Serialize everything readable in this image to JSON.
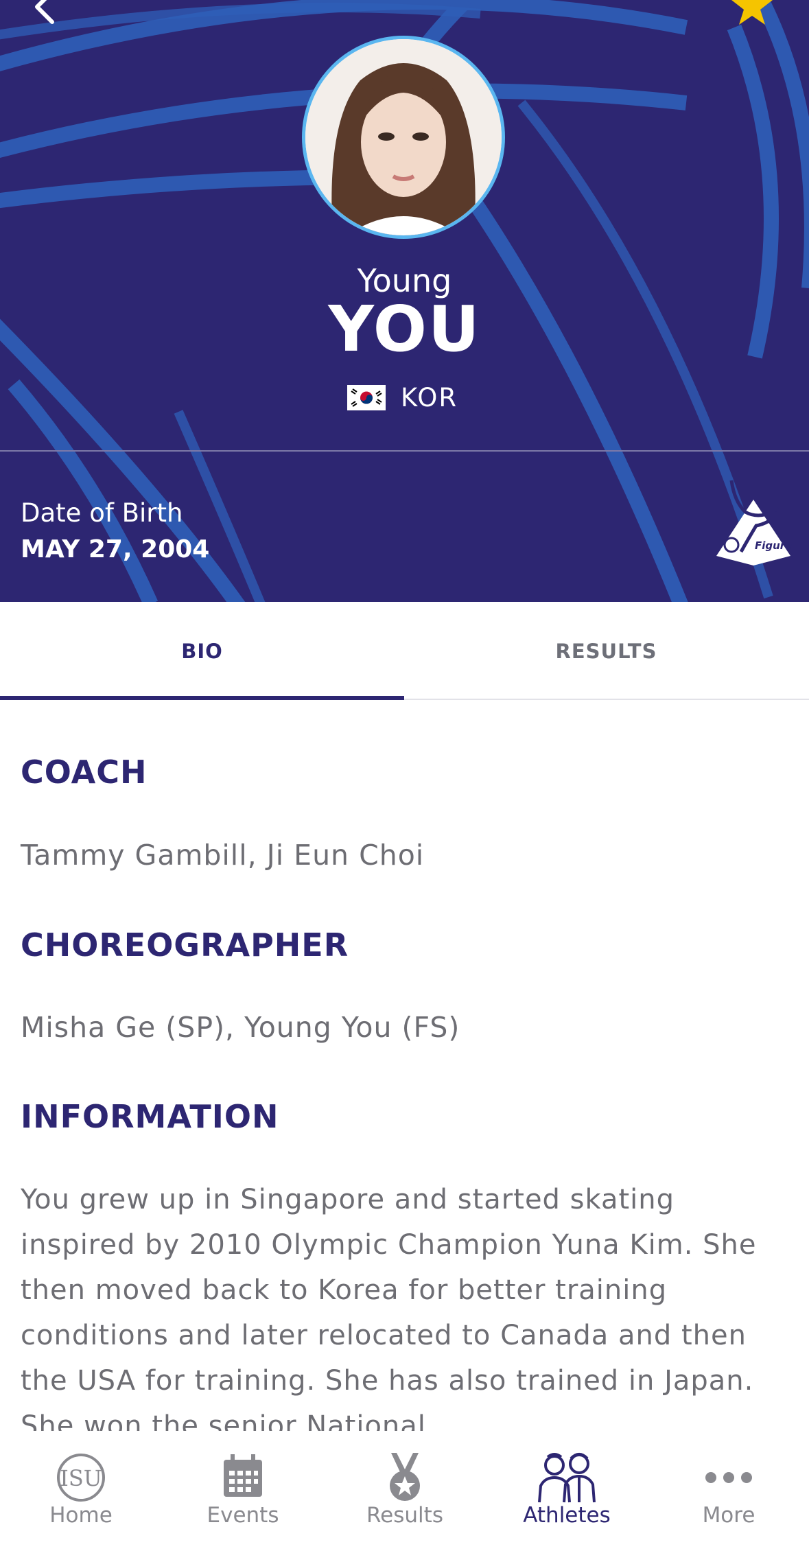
{
  "header": {
    "back_icon": "chevron-left-icon",
    "favorite_icon": "star-icon",
    "favorite_color": "#f5c400"
  },
  "athlete": {
    "first_name": "Young",
    "last_name": "YOU",
    "nation_code": "KOR",
    "dob_label": "Date of Birth",
    "dob_value": "MAY 27, 2004"
  },
  "tabs": [
    {
      "label": "BIO",
      "active": true
    },
    {
      "label": "RESULTS",
      "active": false
    }
  ],
  "bio": {
    "coach_title": "COACH",
    "coach_value": "Tammy Gambill, Ji Eun Choi",
    "choreographer_title": "CHOREOGRAPHER",
    "choreographer_value": "Misha Ge (SP), Young You (FS)",
    "information_title": "INFORMATION",
    "information_text": "You grew up in Singapore and started skating inspired by 2010 Olympic Champion Yuna Kim. She then moved back to Korea for better training conditions and later relocated to Canada and then the USA for training. She has also trained in Japan. She won the senior National"
  },
  "nav": [
    {
      "label": "Home",
      "icon": "isu-logo-icon",
      "active": false
    },
    {
      "label": "Events",
      "icon": "calendar-icon",
      "active": false
    },
    {
      "label": "Results",
      "icon": "medal-icon",
      "active": false
    },
    {
      "label": "Athletes",
      "icon": "athletes-icon",
      "active": true
    },
    {
      "label": "More",
      "icon": "more-dots-icon",
      "active": false
    }
  ],
  "colors": {
    "primary": "#2d2672",
    "accent_ring": "#5ab6f0",
    "arc": "#2f5fb8"
  }
}
